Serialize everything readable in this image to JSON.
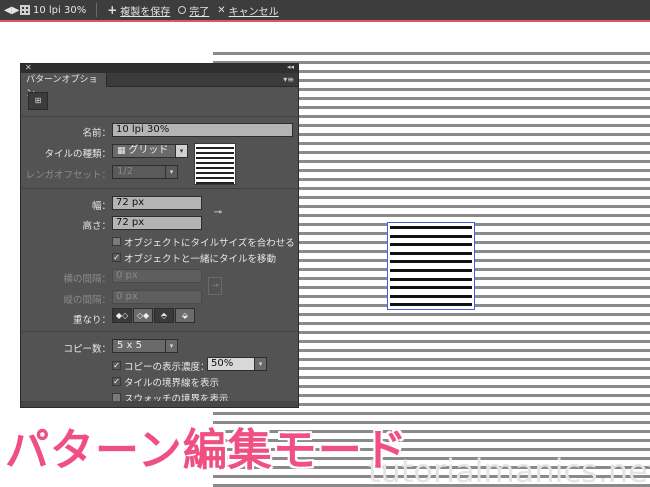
{
  "topbar": {
    "tile_name": "10 lpi 30%",
    "save_copy": "複製を保存",
    "done": "完了",
    "cancel": "キャンセル",
    "accent_color": "#e0546a"
  },
  "panel": {
    "tab_title": "パターンオプション",
    "name_label": "名前：",
    "name_value": "10 lpi 30%",
    "tile_type_label": "タイルの種類：",
    "tile_type_value": "グリッド",
    "brick_offset_label": "レンガオフセット：",
    "brick_offset_value": "1/2",
    "width_label": "幅：",
    "width_value": "72 px",
    "height_label": "高さ：",
    "height_value": "72 px",
    "size_tile_to_art": "オブジェクトにタイルサイズを合わせる",
    "size_tile_to_art_checked": false,
    "move_tile_with_art": "オブジェクトと一緒にタイルを移動",
    "move_tile_with_art_checked": true,
    "h_spacing_label": "横の間隔：",
    "h_spacing_value": "0 px",
    "v_spacing_label": "縦の間隔：",
    "v_spacing_value": "0 px",
    "overlap_label": "重なり：",
    "copies_label": "コピー数：",
    "copies_value": "5 x 5",
    "dim_copies_label": "コピーの表示濃度：",
    "dim_copies_value": "50%",
    "dim_copies_checked": true,
    "show_tile_edge": "タイルの境界線を表示",
    "show_tile_edge_checked": true,
    "show_swatch_bounds": "スウォッチの境界を表示",
    "show_swatch_bounds_checked": false
  },
  "caption": {
    "text": "パターン編集モード",
    "color": "#ef4f82"
  },
  "watermark": "tutorialmanics.net",
  "icons": {
    "back": "back-arrow-icon",
    "tile": "pattern-tile-icon",
    "add": "plus-icon",
    "done": "circle-icon",
    "cancel": "x-icon",
    "link": "link-chain-icon",
    "grid": "grid-icon"
  }
}
